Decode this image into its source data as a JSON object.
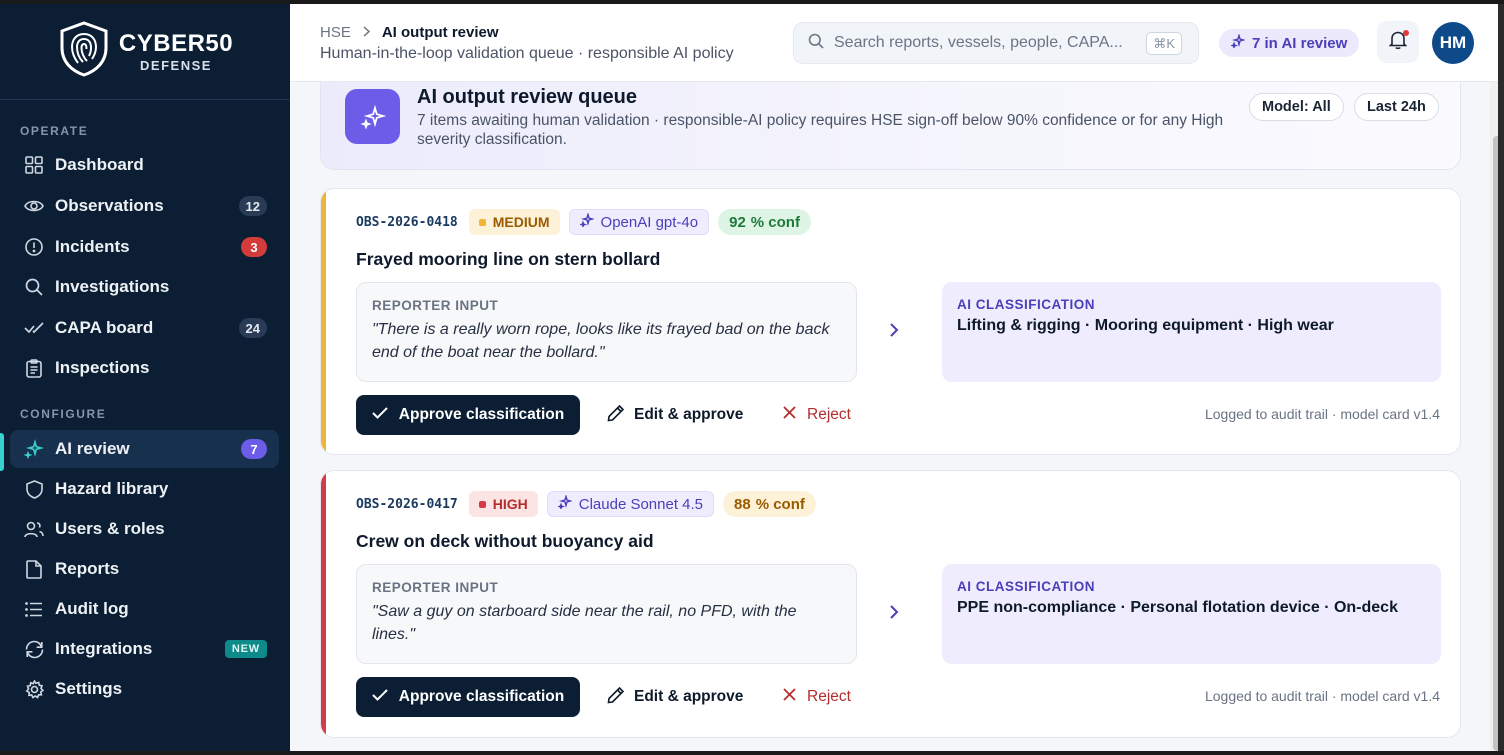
{
  "brand": {
    "name": "CYBER50",
    "sub": "DEFENSE"
  },
  "sidebar": {
    "sections": [
      {
        "label": "OPERATE"
      },
      {
        "label": "CONFIGURE"
      }
    ],
    "items": [
      {
        "label": "Dashboard",
        "icon": "grid-icon",
        "badge": ""
      },
      {
        "label": "Observations",
        "icon": "eye-icon",
        "badge": "12"
      },
      {
        "label": "Incidents",
        "icon": "alert-circle-icon",
        "badge": "3"
      },
      {
        "label": "Investigations",
        "icon": "search-icon",
        "badge": ""
      },
      {
        "label": "CAPA board",
        "icon": "check-trend-icon",
        "badge": "24"
      },
      {
        "label": "Inspections",
        "icon": "clipboard-icon",
        "badge": ""
      },
      {
        "label": "AI review",
        "icon": "sparkle-icon",
        "badge": "7",
        "active": true
      },
      {
        "label": "Hazard library",
        "icon": "shield-icon",
        "badge": ""
      },
      {
        "label": "Users & roles",
        "icon": "users-icon",
        "badge": ""
      },
      {
        "label": "Reports",
        "icon": "file-icon",
        "badge": ""
      },
      {
        "label": "Audit log",
        "icon": "list-icon",
        "badge": ""
      },
      {
        "label": "Integrations",
        "icon": "refresh-icon",
        "badge": "NEW"
      },
      {
        "label": "Settings",
        "icon": "gear-icon",
        "badge": ""
      }
    ]
  },
  "header": {
    "breadcrumb_root": "HSE",
    "breadcrumb_current": "AI output review",
    "subtitle": "Human-in-the-loop validation queue · responsible AI policy",
    "search_placeholder": "Search reports, vessels, people, CAPA...",
    "search_shortcut": "⌘K",
    "ai_pill": "7 in AI review",
    "avatar_initials": "HM"
  },
  "queue": {
    "title": "AI output review queue",
    "description": "7 items awaiting human validation · responsible-AI policy requires HSE sign-off below 90% confidence or for any High severity classification.",
    "filter_model": "Model: All",
    "filter_time": "Last 24h"
  },
  "cards": [
    {
      "id": "OBS-2026-0418",
      "severity": "MEDIUM",
      "model": "OpenAI gpt-4o",
      "confidence": "92",
      "conf_unit": "% conf",
      "title": "Frayed mooring line on stern bollard",
      "input_label": "REPORTER INPUT",
      "input_text": "\"There is a really worn rope, looks like its frayed bad on the back end of the boat near the bollard.\"",
      "ai_label": "AI CLASSIFICATION",
      "ai_text": "Lifting & rigging · Mooring equipment · High wear",
      "approve": "Approve classification",
      "edit": "Edit & approve",
      "reject": "Reject",
      "audit": "Logged to audit trail · model card v1.4"
    },
    {
      "id": "OBS-2026-0417",
      "severity": "HIGH",
      "model": "Claude Sonnet 4.5",
      "confidence": "88",
      "conf_unit": "% conf",
      "title": "Crew on deck without buoyancy aid",
      "input_label": "REPORTER INPUT",
      "input_text": "\"Saw a guy on starboard side near the rail, no PFD, with the lines.\"",
      "ai_label": "AI CLASSIFICATION",
      "ai_text": "PPE non-compliance · Personal flotation device · On-deck",
      "approve": "Approve classification",
      "edit": "Edit & approve",
      "reject": "Reject",
      "audit": "Logged to audit trail · model card v1.4"
    }
  ],
  "colors": {
    "sidebar_bg": "#0b1e33",
    "accent_purple": "#6c5ce7",
    "medium_accent": "#f0b43c",
    "high_accent": "#d43b4a",
    "teal": "#3ad0ce"
  }
}
